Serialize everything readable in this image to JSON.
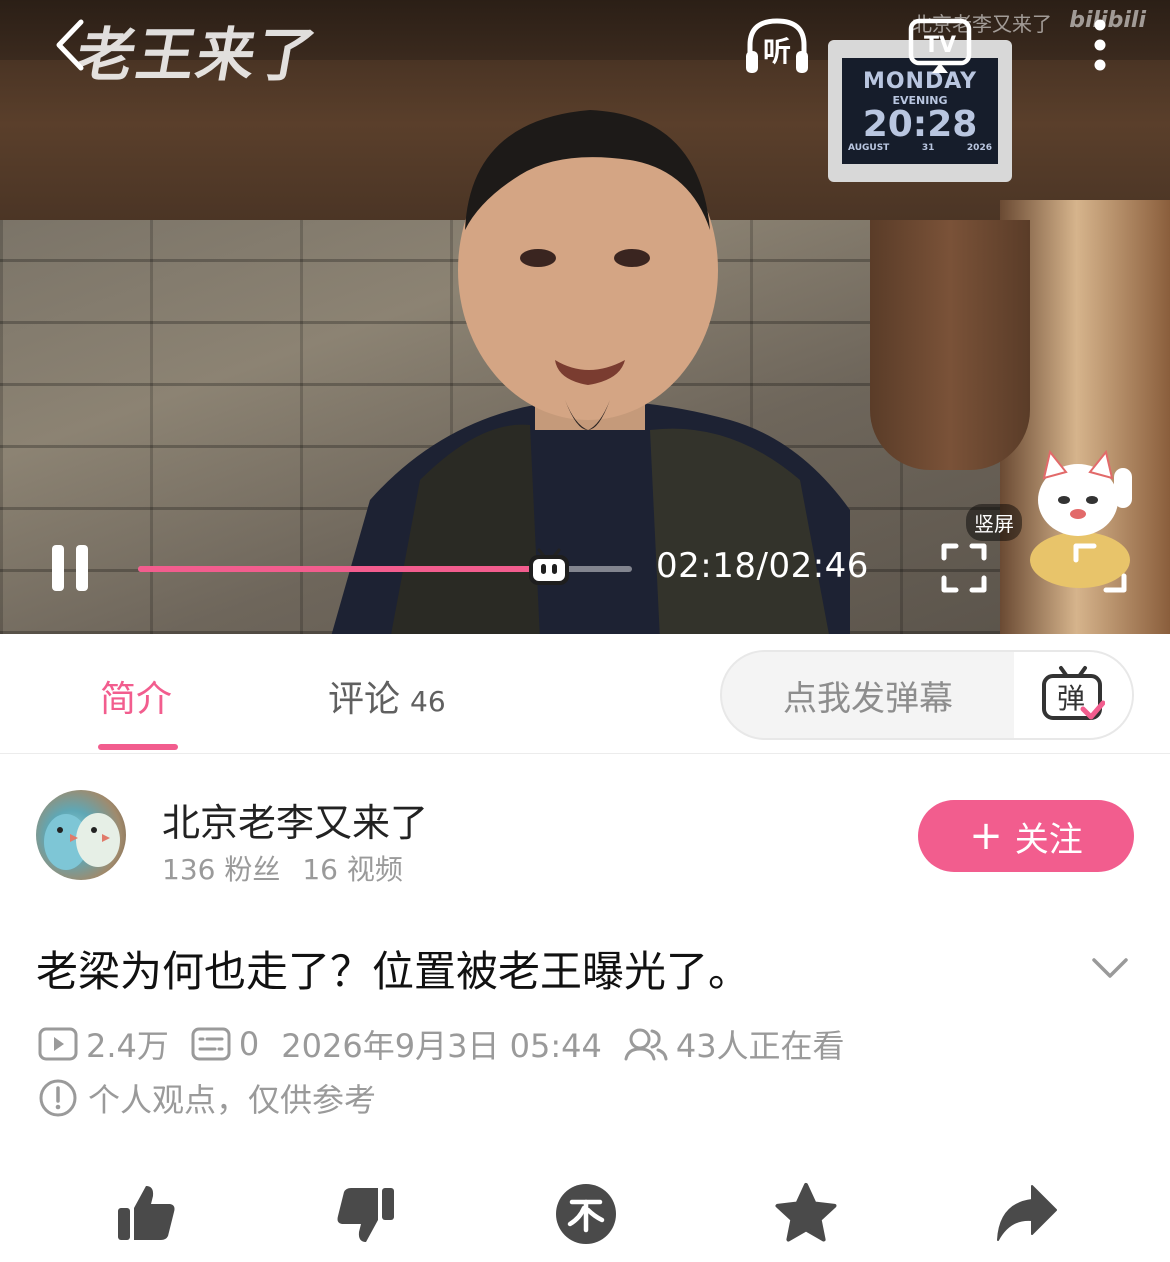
{
  "video": {
    "watermark_logo": "老王来了",
    "watermark_channel": "北京老李又来了",
    "watermark_site": "bilibili",
    "clock": {
      "day": "MONDAY",
      "period": "EVENING",
      "time": "20:28",
      "month": "AUGUST",
      "date": "31",
      "year": "2026"
    },
    "listen_label": "听",
    "tv_label": "TV",
    "progress_fraction": 0.8313,
    "time_display": "02:18/02:46",
    "portrait_label": "竖屏"
  },
  "tabs": {
    "intro_label": "简介",
    "comments_label": "评论",
    "comments_count": "46",
    "danmaku_placeholder": "点我发弹幕",
    "danmaku_icon_label": "弹"
  },
  "uploader": {
    "name": "北京老李又来了",
    "fans": "136 粉丝",
    "videos": "16 视频",
    "follow_label": "关注"
  },
  "title": "老梁为何也走了？位置被老王曝光了。",
  "meta": {
    "views": "2.4万",
    "danmaku": "0",
    "date": "2026年9月3日 05:44",
    "watching": "43人正在看",
    "note": "个人观点，仅供参考"
  },
  "colors": {
    "accent": "#f25d8e",
    "meta_gray": "#9a9a9a",
    "icon_dark": "#4a4a4a"
  },
  "icons": [
    "back-icon",
    "headphones-icon",
    "tv-cast-icon",
    "more-icon",
    "pause-icon",
    "fullscreen-icon",
    "zoom-icon",
    "danmaku-icon",
    "play-count-icon",
    "danmaku-count-icon",
    "watching-icon",
    "info-icon",
    "chevron-down-icon",
    "thumbs-up-icon",
    "thumbs-down-icon",
    "coin-icon",
    "star-icon",
    "share-icon"
  ]
}
